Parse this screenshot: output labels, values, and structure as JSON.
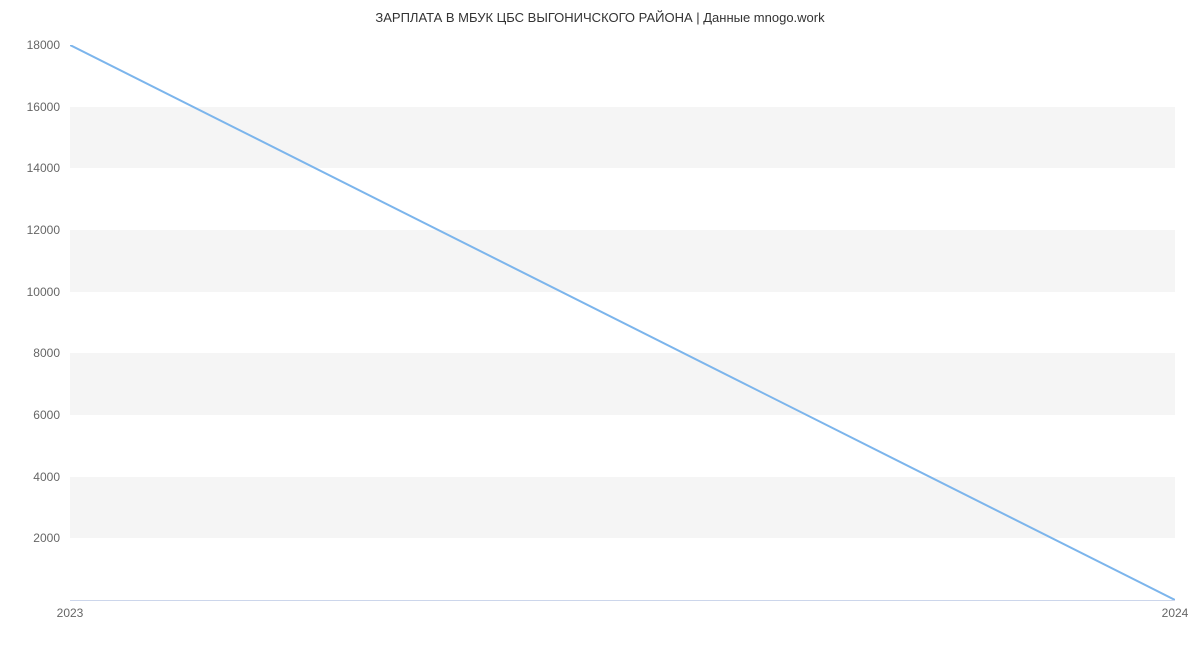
{
  "chart_data": {
    "type": "line",
    "title": "ЗАРПЛАТА В МБУК ЦБС ВЫГОНИЧСКОГО РАЙОНА | Данные mnogo.work",
    "x": [
      2023,
      2024
    ],
    "values": [
      18000,
      0
    ],
    "xlabel": "",
    "ylabel": "",
    "xlim": [
      2023,
      2024
    ],
    "ylim": [
      0,
      18000
    ],
    "y_ticks": [
      2000,
      4000,
      6000,
      8000,
      10000,
      12000,
      14000,
      16000,
      18000
    ],
    "x_ticks": [
      2023,
      2024
    ],
    "line_color": "#7cb5ec",
    "band_color": "#f5f5f5"
  }
}
